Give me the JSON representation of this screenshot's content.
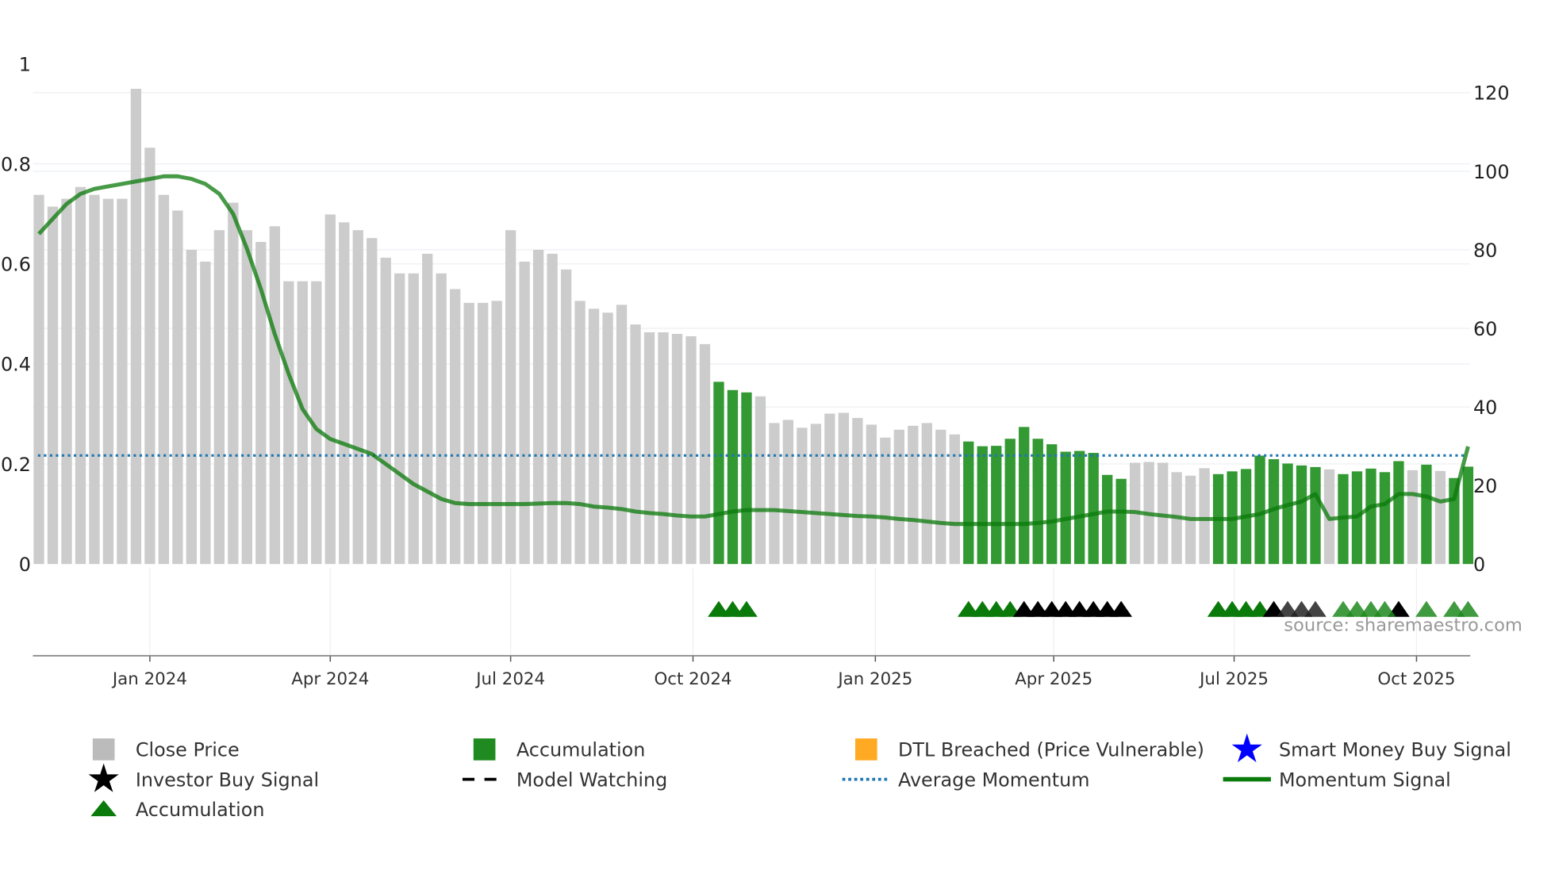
{
  "chart_data": {
    "type": "bar",
    "x_start": "2023-11-06",
    "x_step_days": 7,
    "right_axis": {
      "label": "Close Price",
      "ylim": [
        0,
        120
      ],
      "ticks": [
        "0",
        "20",
        "40",
        "60",
        "80",
        "100",
        "120"
      ]
    },
    "left_axis": {
      "label": "Momentum",
      "ylim": [
        0,
        1
      ],
      "ticks": [
        "0",
        "0.2",
        "0.4",
        "0.6",
        "0.8",
        "1"
      ]
    },
    "x_ticks": [
      {
        "label": "Jan 2024",
        "date": "2024-01-01"
      },
      {
        "label": "Apr 2024",
        "date": "2024-04-01"
      },
      {
        "label": "Jul 2024",
        "date": "2024-07-01"
      },
      {
        "label": "Oct 2024",
        "date": "2024-10-01"
      },
      {
        "label": "Jan 2025",
        "date": "2025-01-01"
      },
      {
        "label": "Apr 2025",
        "date": "2025-04-01"
      },
      {
        "label": "Jul 2025",
        "date": "2025-07-01"
      },
      {
        "label": "Oct 2025",
        "date": "2025-10-01"
      }
    ],
    "close_price": [
      94,
      91,
      93,
      96,
      94,
      93,
      93,
      121,
      106,
      94,
      90,
      80,
      77,
      85,
      92,
      85,
      82,
      86,
      72,
      72,
      72,
      89,
      87,
      85,
      83,
      78,
      74,
      74,
      79,
      74,
      70,
      66.5,
      66.5,
      67,
      85,
      77,
      80,
      79,
      75,
      67,
      65,
      64,
      66,
      61,
      59,
      59,
      58.6,
      58,
      56,
      46.4,
      44.3,
      43.7,
      42.7,
      35.9,
      36.7,
      34.7,
      35.7,
      38.3,
      38.5,
      37.2,
      35.5,
      32.2,
      34.2,
      35.2,
      35.9,
      34.2,
      33,
      31.2,
      30,
      30.1,
      31.9,
      34.9,
      31.9,
      30.5,
      28.6,
      28.8,
      28.3,
      22.7,
      21.7,
      25.8,
      26,
      25.8,
      23.4,
      22.5,
      24.4,
      22.9,
      23.6,
      24.2,
      27.6,
      26.7,
      25.6,
      25.1,
      24.7,
      24.1,
      22.9,
      23.6,
      24.3,
      23.4,
      26.2,
      23.9,
      25.3,
      23.7,
      21.9,
      24.8
    ],
    "accumulation_bars": [
      50,
      51,
      52,
      68,
      69,
      70,
      71,
      72,
      73,
      74,
      75,
      76,
      77,
      78,
      79,
      86,
      87,
      88,
      89,
      90,
      91,
      92,
      93,
      95,
      96,
      97,
      98,
      99,
      101,
      103,
      104
    ],
    "momentum": [
      0.66,
      0.69,
      0.72,
      0.74,
      0.75,
      0.755,
      0.76,
      0.765,
      0.77,
      0.775,
      0.775,
      0.77,
      0.76,
      0.74,
      0.7,
      0.63,
      0.55,
      0.46,
      0.38,
      0.31,
      0.27,
      0.25,
      0.24,
      0.23,
      0.22,
      0.2,
      0.18,
      0.16,
      0.145,
      0.13,
      0.122,
      0.12,
      0.12,
      0.12,
      0.12,
      0.12,
      0.121,
      0.122,
      0.122,
      0.12,
      0.115,
      0.113,
      0.11,
      0.105,
      0.102,
      0.1,
      0.097,
      0.095,
      0.095,
      0.1,
      0.105,
      0.108,
      0.108,
      0.108,
      0.106,
      0.104,
      0.102,
      0.1,
      0.098,
      0.096,
      0.095,
      0.093,
      0.09,
      0.088,
      0.085,
      0.082,
      0.08,
      0.08,
      0.08,
      0.08,
      0.08,
      0.08,
      0.082,
      0.085,
      0.09,
      0.095,
      0.1,
      0.105,
      0.105,
      0.104,
      0.1,
      0.097,
      0.094,
      0.09,
      0.09,
      0.09,
      0.09,
      0.095,
      0.1,
      0.11,
      0.118,
      0.125,
      0.14,
      0.09,
      0.093,
      0.095,
      0.115,
      0.12,
      0.14,
      0.14,
      0.135,
      0.125,
      0.13,
      0.235
    ],
    "average_momentum": 0.217,
    "markers": [
      {
        "bars": [
          50,
          51,
          52,
          68,
          69,
          70,
          71,
          86,
          87,
          88,
          89
        ],
        "kind": "accumulation"
      },
      {
        "bars": [
          72,
          73,
          74,
          75,
          76,
          77,
          78,
          79,
          90,
          99
        ],
        "kind": "investor"
      },
      {
        "bars": [
          91,
          92,
          93
        ],
        "kind": "investor-faded"
      },
      {
        "bars": [
          95,
          96,
          97,
          98,
          101,
          103,
          104
        ],
        "kind": "accumulation-faded"
      }
    ],
    "source": "source: sharemaestro.com",
    "legend": [
      {
        "label": "Close Price",
        "symbol": "square",
        "color": "#bbbbbb"
      },
      {
        "label": "Accumulation",
        "symbol": "square",
        "color": "#1f8a1f"
      },
      {
        "label": "DTL Breached (Price Vulnerable)",
        "symbol": "square",
        "color": "#ffaa22"
      },
      {
        "label": "Smart Money Buy Signal",
        "symbol": "star",
        "color": "#0000ff"
      },
      {
        "label": "Investor Buy Signal",
        "symbol": "star",
        "color": "#000000"
      },
      {
        "label": "Model Watching",
        "symbol": "dash",
        "color": "#000000"
      },
      {
        "label": "Average Momentum",
        "symbol": "dot",
        "color": "#1f77b4"
      },
      {
        "label": "Momentum Signal",
        "symbol": "line",
        "color": "#0a7a0a"
      },
      {
        "label": "Accumulation",
        "symbol": "triangle",
        "color": "#0a7a0a"
      }
    ],
    "colors": {
      "price": "#cccccc",
      "accumulation": "#339933",
      "momentum": "#0a7a0a",
      "average": "#1f77b4",
      "axis": "#888888"
    }
  }
}
